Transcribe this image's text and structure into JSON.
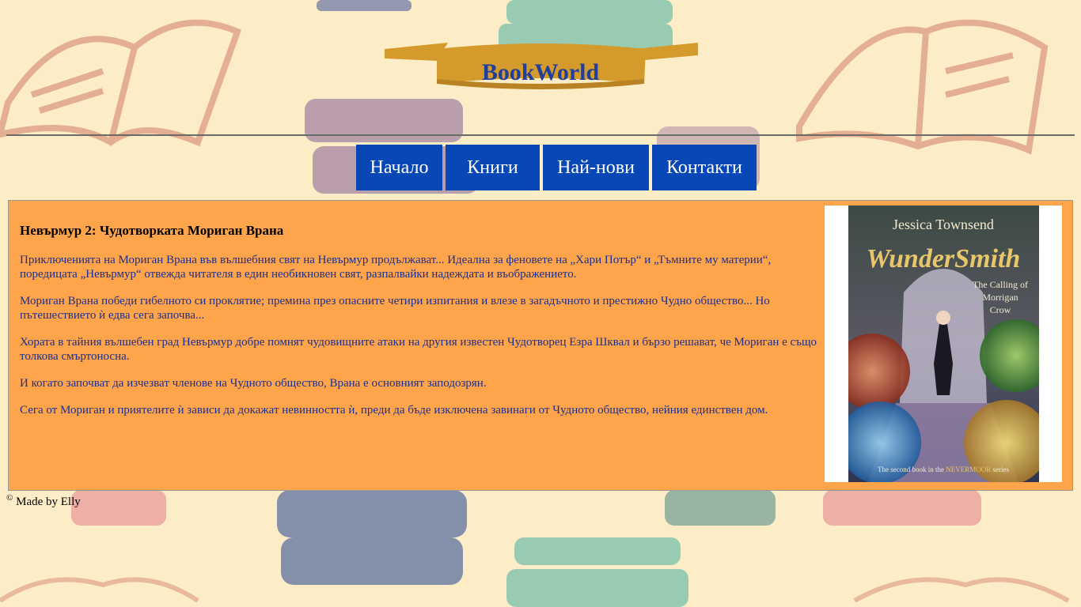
{
  "brand": {
    "name": "BookWorld"
  },
  "nav": {
    "items": [
      "Начало",
      "Книги",
      "Най-нови",
      "Контакти"
    ]
  },
  "book": {
    "title": "Невърмур 2: Чудотворката Мориган Врана",
    "paragraphs": [
      " Приключенията на Мориган Врана във вълшебния свят на Невърмур продължават... Идеална за феновете на „Хари Потър“ и „Тъмните му материи“, поредицата „Невърмур“ отвежда читателя в един необикновен свят, разпалвайки надеждата и въображението.",
      "Мориган Врана победи гибелното си проклятие; премина през опасните четири изпитания и влезе в загадъчното и престижно Чудно общество... Но пътешествието ѝ едва сега започва...",
      "Хората в тайния вълшебен град Невърмур добре помнят чудовищните атаки на другия известен Чудотворец Езра Шквал и бързо решават, че Мориган е също толкова смъртоносна.",
      "И когато започват да изчезват членове на Чудното общество, Врана е основният заподозрян.",
      "Сега от Мориган и приятелите ѝ зависи да докажат невинността ѝ, преди да бъде изключена завинаги от Чудното общество, нейния единствен дом."
    ],
    "cover": {
      "author": "Jessica Townsend",
      "title": "WunderSmith",
      "subtitle_line1": "The Calling of",
      "subtitle_line2": "Morrigan",
      "subtitle_line3": "Crow",
      "series_note_pre": "The second book in the",
      "series_note_brand": "NEVERMOOR",
      "series_note_post": "series"
    }
  },
  "footer": {
    "copyright_symbol": "©",
    "text": "Made by Elly"
  },
  "colors": {
    "background": "#fdedc6",
    "nav": "#0747b6",
    "content": "#fea54b",
    "brand_text": "#1f3f9a",
    "banner": "#d59a2c"
  }
}
